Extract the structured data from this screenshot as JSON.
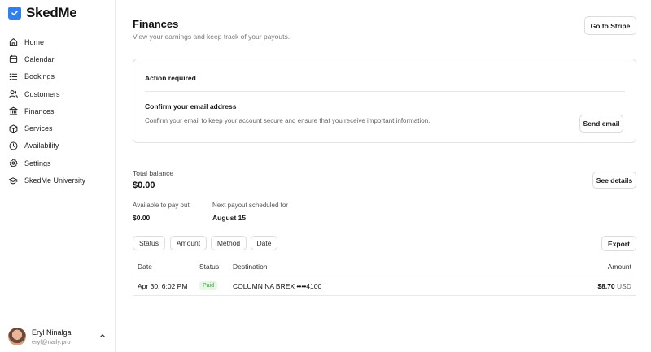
{
  "app": {
    "name": "SkedMe"
  },
  "sidebar": {
    "items": [
      {
        "label": "Home",
        "icon": "home-icon"
      },
      {
        "label": "Calendar",
        "icon": "calendar-icon"
      },
      {
        "label": "Bookings",
        "icon": "list-icon"
      },
      {
        "label": "Customers",
        "icon": "users-icon"
      },
      {
        "label": "Finances",
        "icon": "bank-icon"
      },
      {
        "label": "Services",
        "icon": "box-icon"
      },
      {
        "label": "Availability",
        "icon": "clock-icon"
      },
      {
        "label": "Settings",
        "icon": "gear-icon"
      },
      {
        "label": "SkedMe University",
        "icon": "graduation-cap-icon"
      }
    ],
    "user": {
      "name": "Eryl Ninalga",
      "email": "eryl@naily.pro"
    }
  },
  "page": {
    "title": "Finances",
    "subtitle": "View your earnings and keep track of your payouts.",
    "stripe_button": "Go to Stripe"
  },
  "action_card": {
    "title": "Action required",
    "subtitle": "Confirm your email address",
    "body": "Confirm your email to keep your account secure and ensure that you receive important information.",
    "button": "Send email"
  },
  "balance": {
    "label": "Total balance",
    "value": "$0.00",
    "details_button": "See details",
    "available_label": "Available to pay out",
    "available_value": "$0.00",
    "next_label": "Next payout scheduled for",
    "next_value": "August 15"
  },
  "filters": [
    "Status",
    "Amount",
    "Method",
    "Date"
  ],
  "export_button": "Export",
  "table": {
    "columns": [
      "Date",
      "Status",
      "Destination",
      "Amount"
    ],
    "rows": [
      {
        "date": "Apr 30, 6:02 PM",
        "status": "Paid",
        "destination": "COLUMN NA BREX ••••4100",
        "amount": "$8.70",
        "currency": "USD"
      }
    ]
  },
  "colors": {
    "brand": "#2f80ed",
    "paid_bg": "#e7f6e7",
    "paid_text": "#3c9a3c"
  }
}
